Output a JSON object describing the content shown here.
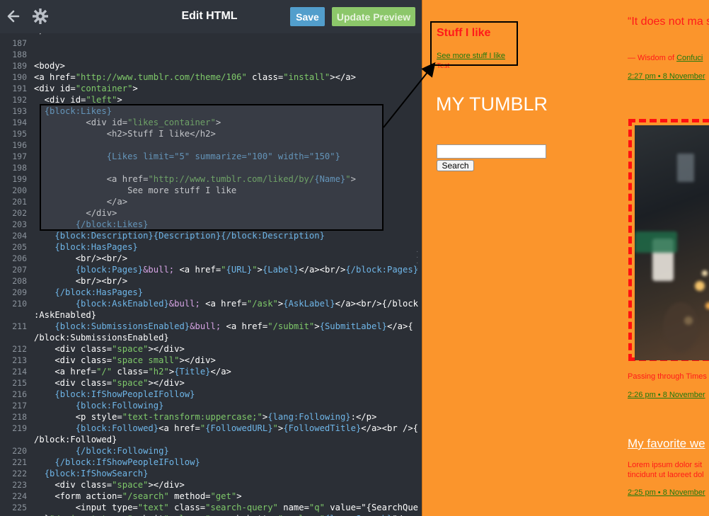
{
  "toolbar": {
    "title": "Edit HTML",
    "save_label": "Save",
    "update_label": "Update Preview",
    "back_icon": "arrow-left-icon",
    "settings_icon": "gear-icon"
  },
  "editor": {
    "top_partial": "</head>",
    "lines": [
      {
        "n": "187",
        "text": ""
      },
      {
        "n": "188",
        "text": ""
      },
      {
        "n": "189",
        "text": "<body>"
      },
      {
        "n": "190",
        "text": "<a href=\"http://www.tumblr.com/theme/106\" class=\"install\"></a>"
      },
      {
        "n": "191",
        "text": "<div id=\"container\">"
      },
      {
        "n": "192",
        "text": "  <div id=\"left\">"
      },
      {
        "n": "193",
        "text": "  {block:Likes}"
      },
      {
        "n": "194",
        "text": "          <div id=\"likes_container\">"
      },
      {
        "n": "195",
        "text": "              <h2>Stuff I like</h2>"
      },
      {
        "n": "196",
        "text": ""
      },
      {
        "n": "197",
        "text": "              {Likes limit=\"5\" summarize=\"100\" width=\"150\"}"
      },
      {
        "n": "198",
        "text": ""
      },
      {
        "n": "199",
        "text": "              <a href=\"http://www.tumblr.com/liked/by/{Name}\">"
      },
      {
        "n": "200",
        "text": "                  See more stuff I like"
      },
      {
        "n": "201",
        "text": "              </a>"
      },
      {
        "n": "202",
        "text": "          </div>"
      },
      {
        "n": "203",
        "text": "        {/block:Likes}"
      },
      {
        "n": "204",
        "text": "    {block:Description}{Description}{/block:Description}"
      },
      {
        "n": "205",
        "text": "    {block:HasPages}"
      },
      {
        "n": "206",
        "text": "        <br/><br/>"
      },
      {
        "n": "207",
        "text": "        {block:Pages}&bull; <a href=\"{URL}\">{Label}</a><br/>{/block:Pages}"
      },
      {
        "n": "208",
        "text": "        <br/><br/>"
      },
      {
        "n": "209",
        "text": "    {/block:HasPages}"
      },
      {
        "n": "210",
        "text": "        {block:AskEnabled}&bull; <a href=\"/ask\">{AskLabel}</a><br/>{/block"
      },
      {
        "n": "",
        "text": ":AskEnabled}"
      },
      {
        "n": "211",
        "text": "    {block:SubmissionsEnabled}&bull; <a href=\"/submit\">{SubmitLabel}</a>{"
      },
      {
        "n": "",
        "text": "/block:SubmissionsEnabled}"
      },
      {
        "n": "212",
        "text": "    <div class=\"space\"></div>"
      },
      {
        "n": "213",
        "text": "    <div class=\"space small\"></div>"
      },
      {
        "n": "214",
        "text": "    <a href=\"/\" class=\"h2\">{Title}</a>"
      },
      {
        "n": "215",
        "text": "    <div class=\"space\"></div>"
      },
      {
        "n": "216",
        "text": "    {block:IfShowPeopleIFollow}"
      },
      {
        "n": "217",
        "text": "        {block:Following}"
      },
      {
        "n": "218",
        "text": "        <p style=\"text-transform:uppercase;\">{lang:Following}:</p>"
      },
      {
        "n": "219",
        "text": "        {block:Followed}<a href=\"{FollowedURL}\">{FollowedTitle}</a><br />{"
      },
      {
        "n": "",
        "text": "/block:Followed}"
      },
      {
        "n": "220",
        "text": "        {/block:Following}"
      },
      {
        "n": "221",
        "text": "    {/block:IfShowPeopleIFollow}"
      },
      {
        "n": "222",
        "text": "  {block:IfShowSearch}"
      },
      {
        "n": "223",
        "text": "    <div class=\"space\"></div>"
      },
      {
        "n": "224",
        "text": "    <form action=\"/search\" method=\"get\">"
      },
      {
        "n": "225",
        "text": "        <input type=\"text\" class=\"search-query\" name=\"q\" value=\"{SearchQue"
      },
      {
        "n": "",
        "text": "ry}\"/><input type=\"submit\" class=\"search-button\" value=\"{lang:Search}\"/>"
      }
    ]
  },
  "preview": {
    "likes_heading": "Stuff I like",
    "likes_link": "See more stuff I like",
    "description": "Test",
    "blog_title": "MY TUMBLR",
    "search_button": "Search",
    "quote_text": "“It does not ma stop.”",
    "quote_source_prefix": "— Wisdom of ",
    "quote_source_link": "Confuci",
    "post1_date": "2:27 pm  •  8 November",
    "photo_caption": "Passing through Times",
    "post2_date": "2:26 pm  •  8 November",
    "text_post_title": "My favorite we",
    "text_post_body_1": "Lorem ipsum dolor sit",
    "text_post_body_2": "tincidunt ut laoreet dol",
    "post3_date": "2:25 pm  •  8 November"
  },
  "colors": {
    "editor_bg": "#2b2f36",
    "save_blue": "#529ecc",
    "update_green": "#8cc76a",
    "preview_orange": "#fb952c",
    "accent_red": "#ff1a1a",
    "link_green": "#1e7a0e"
  }
}
